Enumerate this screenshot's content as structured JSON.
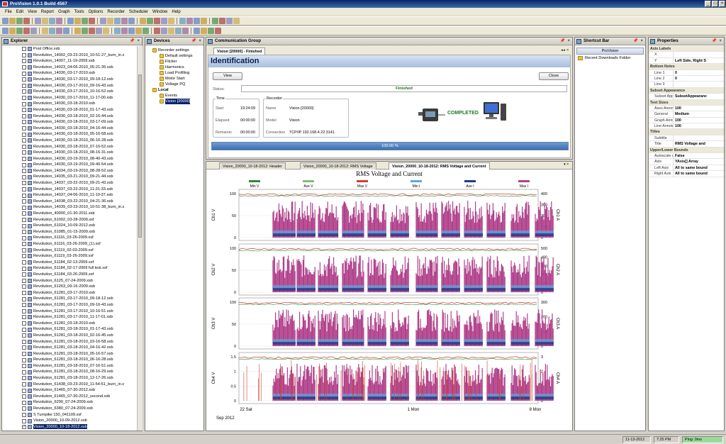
{
  "window": {
    "title": "ProVision 1.0.1 Build 4567",
    "minimize": "_",
    "maximize": "□",
    "close": "×"
  },
  "menu": [
    "File",
    "Edit",
    "View",
    "Report",
    "Graph",
    "Tools",
    "Options",
    "Recorder",
    "Scheduler",
    "Window",
    "Help"
  ],
  "explorer": {
    "title": "Explorer",
    "items": [
      "Post Office.xsb",
      "Revolution_14002_03-23-2010_10-51-27_burn_in.x",
      "Revolution_14007_11-19-2009.xsb",
      "Revolution_14023_04-06-2010_05-21-35.xsb",
      "Revolution_14030_03-17-2010.xsb",
      "Revolution_14030_03-17-2010_09-18-12.xsb",
      "Revolution_14030_03-17-2010_09-16-43.xsb",
      "Revolution_14030_03-17-2010_10-16-52.xsb",
      "Revolution_14030_03-17-2010_11-17-00.xsb",
      "Revolution_14030_03-18-2010.xsb",
      "Revolution_14030_03-18-2010_01-17-43.xsb",
      "Revolution_14030_03-18-2010_02-16-44.xsb",
      "Revolution_14030_03-18-2010_03-17-09.xsb",
      "Revolution_14030_03-18-2010_04-16-44.xsb",
      "Revolution_14030_03-18-2010_05-16-58.xsb",
      "Revolution_14030_03-18-2010_06-16-28.xsb",
      "Revolution_14030_03-18-2010_07-16-52.xsb",
      "Revolution_14030_03-18-2010_08-16-31.xsb",
      "Revolution_14030_03-19-2010_08-40-43.xsb",
      "Revolution_14030_03-19-2010_09-40-54.xsb",
      "Revolution_14034_03-19-2010_08-28-52.xsb",
      "Revolution_14035_03-21-2010_09-21-44.xsb",
      "Revolution_14037_03-22-2010_09-21-43.xsb",
      "Revolution_14037_03-22-2010_11-31-33.xsb",
      "Revolution_14037_04-06-2010_11-10-37.xsb",
      "Revolution_14038_03-22-2010_04-21-36.xsb",
      "Revolution_14039_03-23-2010_10-51-38_burn_in.x",
      "Revolution_40000_01-30-2011.xsb",
      "Revolution_61002_03-28-2009.xsf",
      "Revolution_61024_10-09-2012.xsb",
      "Revolution_61085_01-15-2009.xsb",
      "Revolution_61116_03-26-2009.xsf",
      "Revolution_61116_03-26-2009_(1).xsf",
      "Revolution_61119_02-03-2009.xsf",
      "Revolution_61119_03-26-2009.xsf",
      "Revolution_61184_02-13-2009.xsf",
      "Revolution_61184_02-17-2009 full test.xsf",
      "Revolution_61184_03-26-2009.xsf",
      "Revolution_6125_07-24-2009.xsb",
      "Revolution_61263_09-16-2009.xsb",
      "Revolution_61281_03-17-2010.xsb",
      "Revolution_61281_03-17-2010_09-18-12.xsb",
      "Revolution_61281_03-17-2010_09-16-43.xsb",
      "Revolution_61281_03-17-2010_10-16-51.xsb",
      "Revolution_61281_03-17-2010_11-17-01.xsb",
      "Revolution_61281_03-18-2010.xsb",
      "Revolution_61281_03-18-2010_01-17-43.xsb",
      "Revolution_61281_03-18-2010_02-16-45.xsb",
      "Revolution_61281_03-18-2010_03-16-58.xsb",
      "Revolution_61281_03-18-2010_04-16-42.xsb",
      "Revolution_61281_03-18-2010_05-16-57.xsb",
      "Revolution_61281_03-18-2010_06-16-28.xsb",
      "Revolution_61281_03-18-2010_07-16-51.xsb",
      "Revolution_61281_03-18-2010_08-16-29.xsb",
      "Revolution_61281_03-18-2010_12-17-26.xsb",
      "Revolution_61438_03-23-2010_11-54-51_burn_in.x",
      "Revolution_61465_07-30-2012.xsb",
      "Revolution_61465_07-30-2012_second.xsb",
      "Revolution_6290_07-24-2009.xsb",
      "Revolution_6380_07-24-2009.xsb",
      "S Turnpike 150_041109.xsf",
      "Vision_20000_10-09-2012.xsb",
      "Vision_20000_10-18-2012.xsb"
    ]
  },
  "devices": {
    "title": "Devices",
    "tree": [
      {
        "label": "Recorder settings",
        "level": 0
      },
      {
        "label": "Default settings",
        "level": 1
      },
      {
        "label": "Flicker",
        "level": 1
      },
      {
        "label": "Harmonics",
        "level": 1
      },
      {
        "label": "Load Profiling",
        "level": 1
      },
      {
        "label": "Motor Start",
        "level": 1
      },
      {
        "label": "Voltage PQ",
        "level": 1
      },
      {
        "label": "Local",
        "level": 0
      },
      {
        "label": "Events",
        "level": 1
      },
      {
        "label": "Vision [20000]",
        "level": 1
      }
    ]
  },
  "comm": {
    "title": "Communication Group",
    "tab": "Vision [20000] - Finished",
    "heading": "Identification",
    "view_btn": "View",
    "close_btn": "Close",
    "status_label": "Status:",
    "status_value": "Finished",
    "time_group": "Time",
    "start_label": "Start",
    "start_value": "19:24:09",
    "elapsed_label": "Elapsed",
    "elapsed_value": "00:00:00",
    "remain_label": "Remainin",
    "remain_value": "00:00:00",
    "rec_group": "Recorder",
    "name_label": "Name",
    "name_value": "Vision [20000]",
    "model_label": "Model",
    "model_value": "Vision",
    "conn_label": "Connection",
    "conn_value": "TCP/IP 192.168.4.22:3141",
    "completed": "COMPLETED",
    "progress_text": "100.00 %",
    "progress": 1.0
  },
  "graph_tabs": [
    "Vision_20000_10-18-2012: Header",
    "Vision_20000_10-18-2012: RMS Voltage",
    "Vision_20000_10-18-2012: RMS Voltage and Current"
  ],
  "chart_data": {
    "type": "line",
    "title": "RMS Voltage and Current",
    "legend": [
      "Min V",
      "Ave V",
      "Max V",
      "Min I",
      "Ave I",
      "Max I"
    ],
    "legend_colors": [
      "#2e8b3d",
      "#7cc070",
      "#d04030",
      "#5aa8e0",
      "#203a8a",
      "#b0408a"
    ],
    "panels": [
      {
        "ylabel": "Ch1 V",
        "y2label": "Ch1 A",
        "yticks": [
          "100",
          "50",
          "0"
        ],
        "y2ticks": [
          "400",
          "300",
          "200",
          "100",
          "0"
        ]
      },
      {
        "ylabel": "Ch2 V",
        "y2label": "Ch2 A",
        "yticks": [
          "100",
          "50",
          "0"
        ],
        "y2ticks": [
          "500",
          "400",
          "300",
          "200",
          "100",
          "0"
        ]
      },
      {
        "ylabel": "Ch3 V",
        "y2label": "Ch3 A",
        "yticks": [
          "100",
          "50",
          "0"
        ],
        "y2ticks": [
          "300",
          "200",
          "100",
          "0"
        ]
      },
      {
        "ylabel": "Ch4 V",
        "y2label": "Ch4 A",
        "yticks": [
          "1.5",
          "1",
          "0.5",
          "0"
        ],
        "y2ticks": [
          "3",
          "2",
          "1",
          "0"
        ]
      }
    ],
    "xticks": [
      "22 Sat",
      "1 Mon",
      "8 Mon"
    ],
    "xsub": "Sep 2012"
  },
  "shortcut": {
    "title": "Shortcut Bar",
    "header": "ProVision",
    "item": "Recent Downloads Folder"
  },
  "properties": {
    "title": "Properties",
    "rows": [
      {
        "cat": true,
        "k": "Axis Labels"
      },
      {
        "k": "X",
        "v": ""
      },
      {
        "k": "Y",
        "v": "Left Side, Right S"
      },
      {
        "cat": true,
        "k": "Bottom Notes"
      },
      {
        "k": "Line 1",
        "v": "0"
      },
      {
        "k": "Line 2",
        "v": "0"
      },
      {
        "k": "Line 3",
        "v": ""
      },
      {
        "cat": true,
        "k": "Subset Appearance"
      },
      {
        "k": "Subset Appear",
        "v": "SubsetAppearanc"
      },
      {
        "cat": true,
        "k": "Text Sizes"
      },
      {
        "k": "Axes Annotatio",
        "v": "100"
      },
      {
        "k": "General",
        "v": "Medium"
      },
      {
        "k": "Graph Annotat",
        "v": "100"
      },
      {
        "k": "Line Annotatior",
        "v": "100"
      },
      {
        "cat": true,
        "k": "Titles"
      },
      {
        "k": "Subtitle",
        "v": ""
      },
      {
        "k": "Title",
        "v": "RMS Voltage and"
      },
      {
        "cat": true,
        "k": "Upper/Lower Bounds"
      },
      {
        "k": "Autoscale all to",
        "v": "False"
      },
      {
        "k": "Axis",
        "v": "YAxis[] Array"
      },
      {
        "k": "Left Axis",
        "v": "All to same bound"
      },
      {
        "k": "Right Axis",
        "v": "All to same bound"
      }
    ]
  },
  "status": {
    "date": "11-13-2012",
    "time": "7:25 PM",
    "ping": "Ping: 0ms"
  }
}
